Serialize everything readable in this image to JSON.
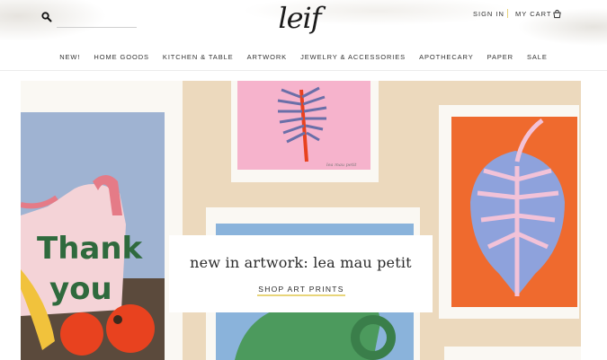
{
  "header": {
    "search": {
      "placeholder": "",
      "value": ""
    },
    "logo_text": "leif",
    "sign_in_label": "SIGN IN",
    "cart_label": "MY CART",
    "accent_color": "#e8d57a"
  },
  "nav": {
    "items": [
      {
        "label": "NEW!"
      },
      {
        "label": "HOME GOODS"
      },
      {
        "label": "KITCHEN & TABLE"
      },
      {
        "label": "ARTWORK"
      },
      {
        "label": "JEWELRY & ACCESSORIES"
      },
      {
        "label": "APOTHECARY"
      },
      {
        "label": "PAPER"
      },
      {
        "label": "SALE"
      }
    ]
  },
  "hero": {
    "title": "new in artwork: lea mau petit",
    "cta_label": "SHOP ART PRINTS",
    "art_text_line1": "Thank",
    "art_text_line2": "you",
    "art_signature": "lea mau petit"
  },
  "icons": {
    "search": "search-icon",
    "cart": "shopping-bag-icon"
  }
}
